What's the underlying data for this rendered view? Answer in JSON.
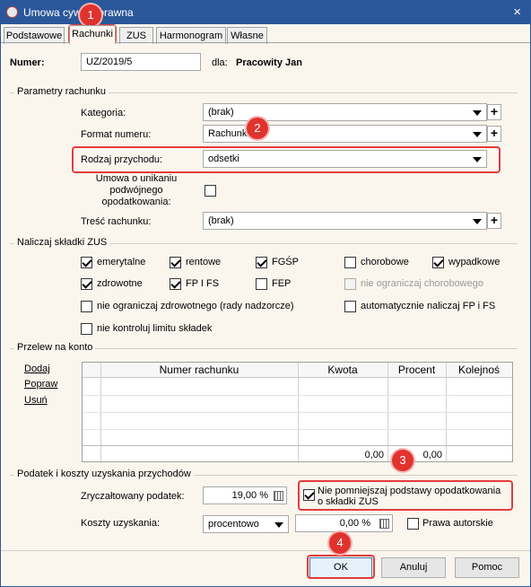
{
  "window": {
    "title": "Umowa cywilnoprawna",
    "close_icon": "×"
  },
  "tabs": [
    {
      "label": "Podstawowe"
    },
    {
      "label": "Rachunki"
    },
    {
      "label": "ZUS"
    },
    {
      "label": "Harmonogram"
    },
    {
      "label": "Własne"
    }
  ],
  "numer": {
    "label": "Numer:",
    "value": "UZ/2019/5",
    "dla_label": "dla:",
    "dla_value": "Pracowity Jan"
  },
  "parametry": {
    "title": "Parametry rachunku",
    "kategoria": {
      "label": "Kategoria:",
      "value": "(brak)"
    },
    "format": {
      "label": "Format numeru:",
      "value": "Rachunki"
    },
    "rodzaj": {
      "label": "Rodzaj przychodu:",
      "value": "odsetki"
    },
    "umowa": {
      "line1": "Umowa o unikaniu",
      "line2": "podwójnego",
      "line3": "opodatkowania:"
    },
    "tresc": {
      "label": "Treść rachunku:",
      "value": "(brak)"
    },
    "plus": "+"
  },
  "zus": {
    "title": "Naliczaj składki ZUS",
    "items": [
      {
        "label": "emerytalne",
        "checked": true
      },
      {
        "label": "rentowe",
        "checked": true
      },
      {
        "label": "FGŚP",
        "checked": true
      },
      {
        "label": "chorobowe",
        "checked": false
      },
      {
        "label": "wypadkowe",
        "checked": true
      },
      {
        "label": "zdrowotne",
        "checked": true
      },
      {
        "label": "FP I FS",
        "checked": true
      },
      {
        "label": "FEP",
        "checked": false
      },
      {
        "label": "nie ograniczaj chorobowego",
        "checked": false,
        "disabled": true
      },
      {
        "label": "nie ograniczaj zdrowotnego (rady nadzorcze)",
        "checked": false
      },
      {
        "label": "automatycznie naliczaj FP i FS",
        "checked": false
      },
      {
        "label": "nie kontroluj limitu składek",
        "checked": false
      }
    ]
  },
  "przelew": {
    "title": "Przelew na konto",
    "links": {
      "dodaj": "Dodaj",
      "popraw": "Popraw",
      "usun": "Usuń"
    },
    "columns": {
      "numer": "Numer rachunku",
      "kwota": "Kwota",
      "procent": "Procent",
      "kolejnosc": "Kolejnoś"
    },
    "totals": {
      "kwota": "0,00",
      "procent": "0,00"
    }
  },
  "podatek": {
    "title": "Podatek i koszty uzyskania przychodów",
    "zryczaltowany": {
      "label": "Zryczałtowany podatek:",
      "value": "19,00 %"
    },
    "nie_pomniejszaj": {
      "line1": "Nie pomniejszaj podstawy opodatkowania",
      "line2": "o składki ZUS",
      "checked": true
    },
    "koszty": {
      "label": "Koszty uzyskania:",
      "select": "procentowo",
      "value": "0,00 %"
    },
    "prawa": {
      "label": "Prawa autorskie",
      "checked": false
    }
  },
  "buttons": {
    "ok": "OK",
    "anuluj": "Anuluj",
    "pomoc": "Pomoc"
  },
  "annotations": {
    "b1": "1",
    "b2": "2",
    "b3": "3",
    "b4": "4"
  },
  "colors": {
    "accent": "#2b579a",
    "highlight": "#e43c3c",
    "background": "#faf6ee"
  }
}
